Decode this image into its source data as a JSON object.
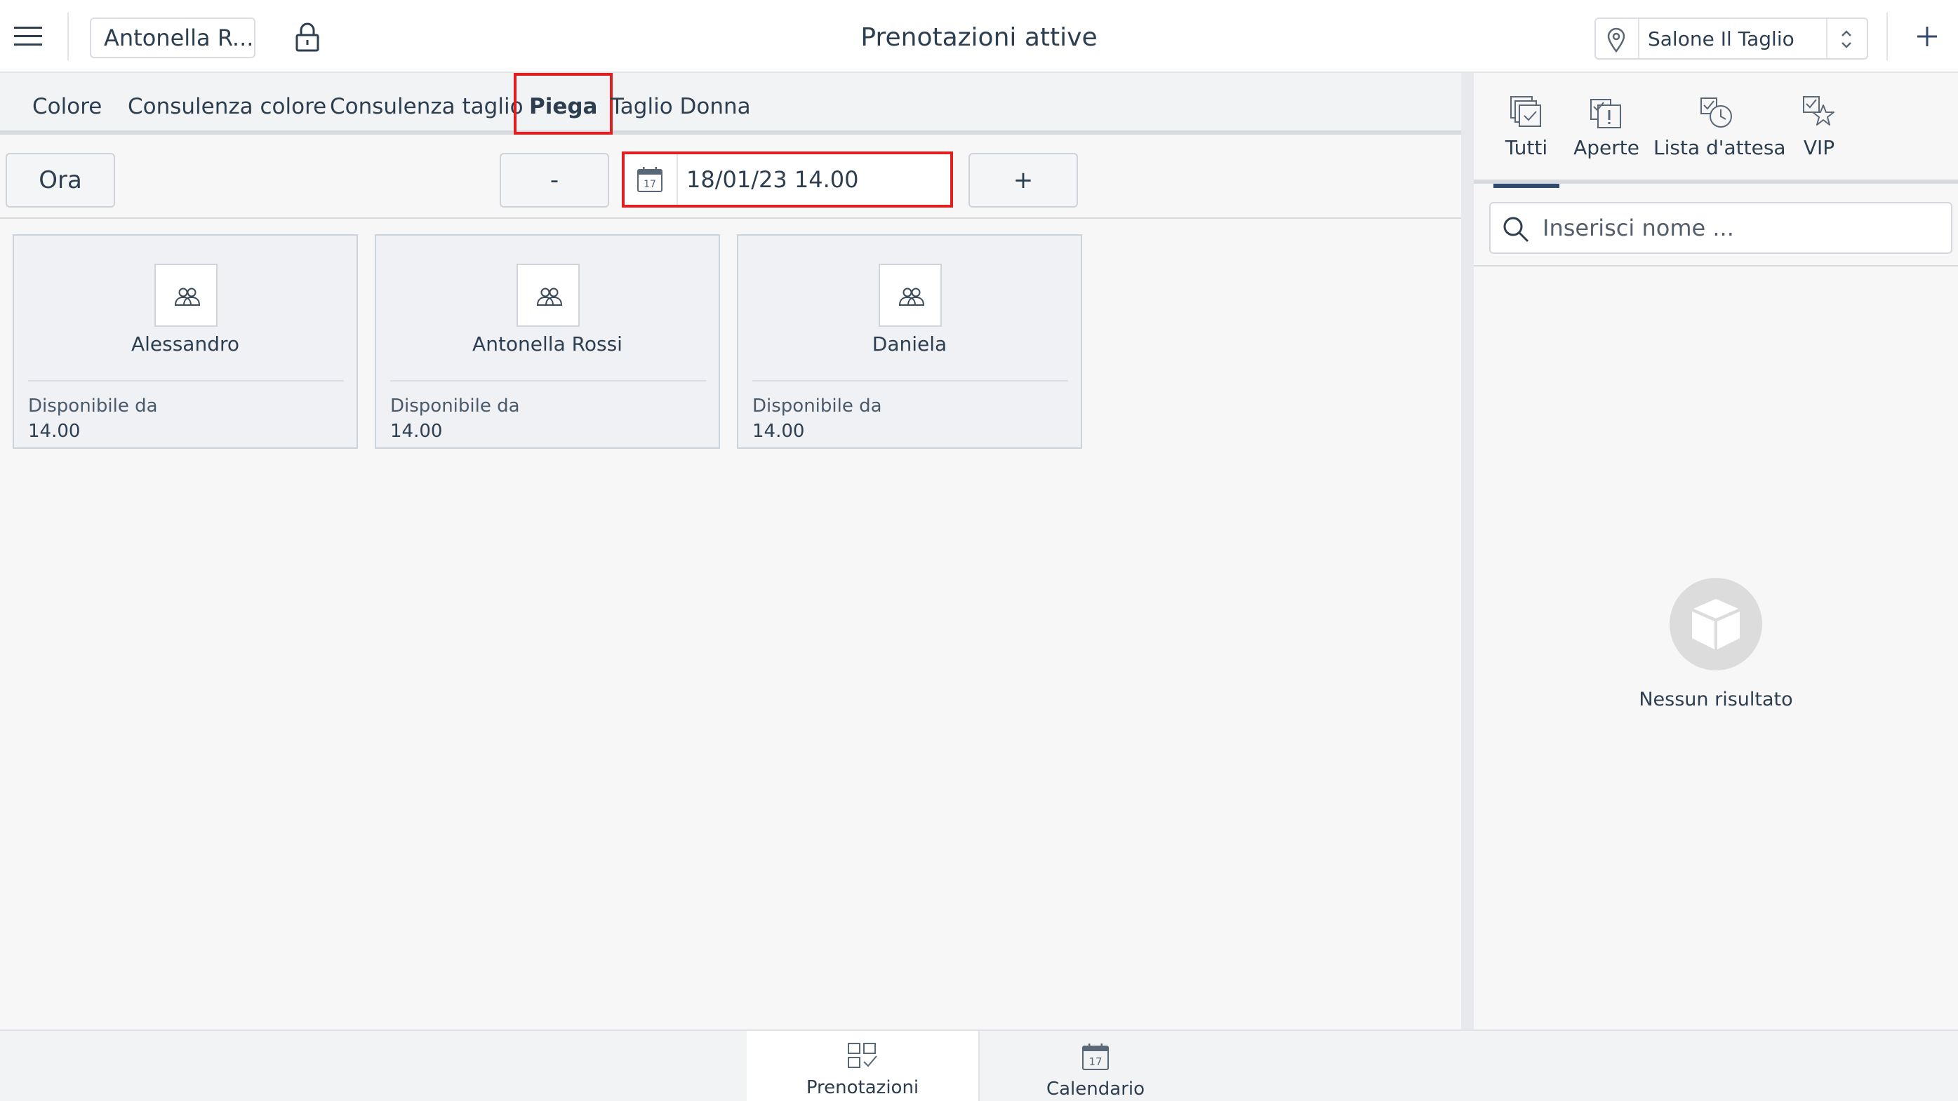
{
  "header": {
    "user_name": "Antonella R...",
    "title": "Prenotazioni attive",
    "location": "Salone Il Taglio"
  },
  "tabs": [
    {
      "label": "Colore"
    },
    {
      "label": "Consulenza colore"
    },
    {
      "label": "Consulenza taglio"
    },
    {
      "label": "Piega",
      "active": true
    },
    {
      "label": "Taglio Donna"
    }
  ],
  "toolbar": {
    "now_label": "Ora",
    "minus_label": "-",
    "plus_label": "+",
    "calendar_day": "17",
    "datetime_value": "18/01/23 14.00"
  },
  "staff": [
    {
      "name": "Alessandro",
      "available_label": "Disponibile da",
      "available_time": "14.00"
    },
    {
      "name": "Antonella Rossi",
      "available_label": "Disponibile da",
      "available_time": "14.00"
    },
    {
      "name": "Daniela",
      "available_label": "Disponibile da",
      "available_time": "14.00"
    }
  ],
  "right_panel": {
    "filters": [
      {
        "label": "Tutti",
        "icon": "all-bookings-icon",
        "active": true
      },
      {
        "label": "Aperte",
        "icon": "open-bookings-icon"
      },
      {
        "label": "Lista d'attesa",
        "icon": "waiting-list-icon"
      },
      {
        "label": "VIP",
        "icon": "vip-star-icon"
      }
    ],
    "search_placeholder": "Inserisci nome ...",
    "empty_text": "Nessun risultato"
  },
  "bottom_nav": [
    {
      "label": "Prenotazioni",
      "icon": "bookings-icon",
      "active": true
    },
    {
      "label": "Calendario",
      "icon": "calendar-icon",
      "calendar_day": "17"
    }
  ],
  "colors": {
    "accent": "#2f4a6d",
    "highlight": "#e02020",
    "text": "#2d3e50"
  }
}
